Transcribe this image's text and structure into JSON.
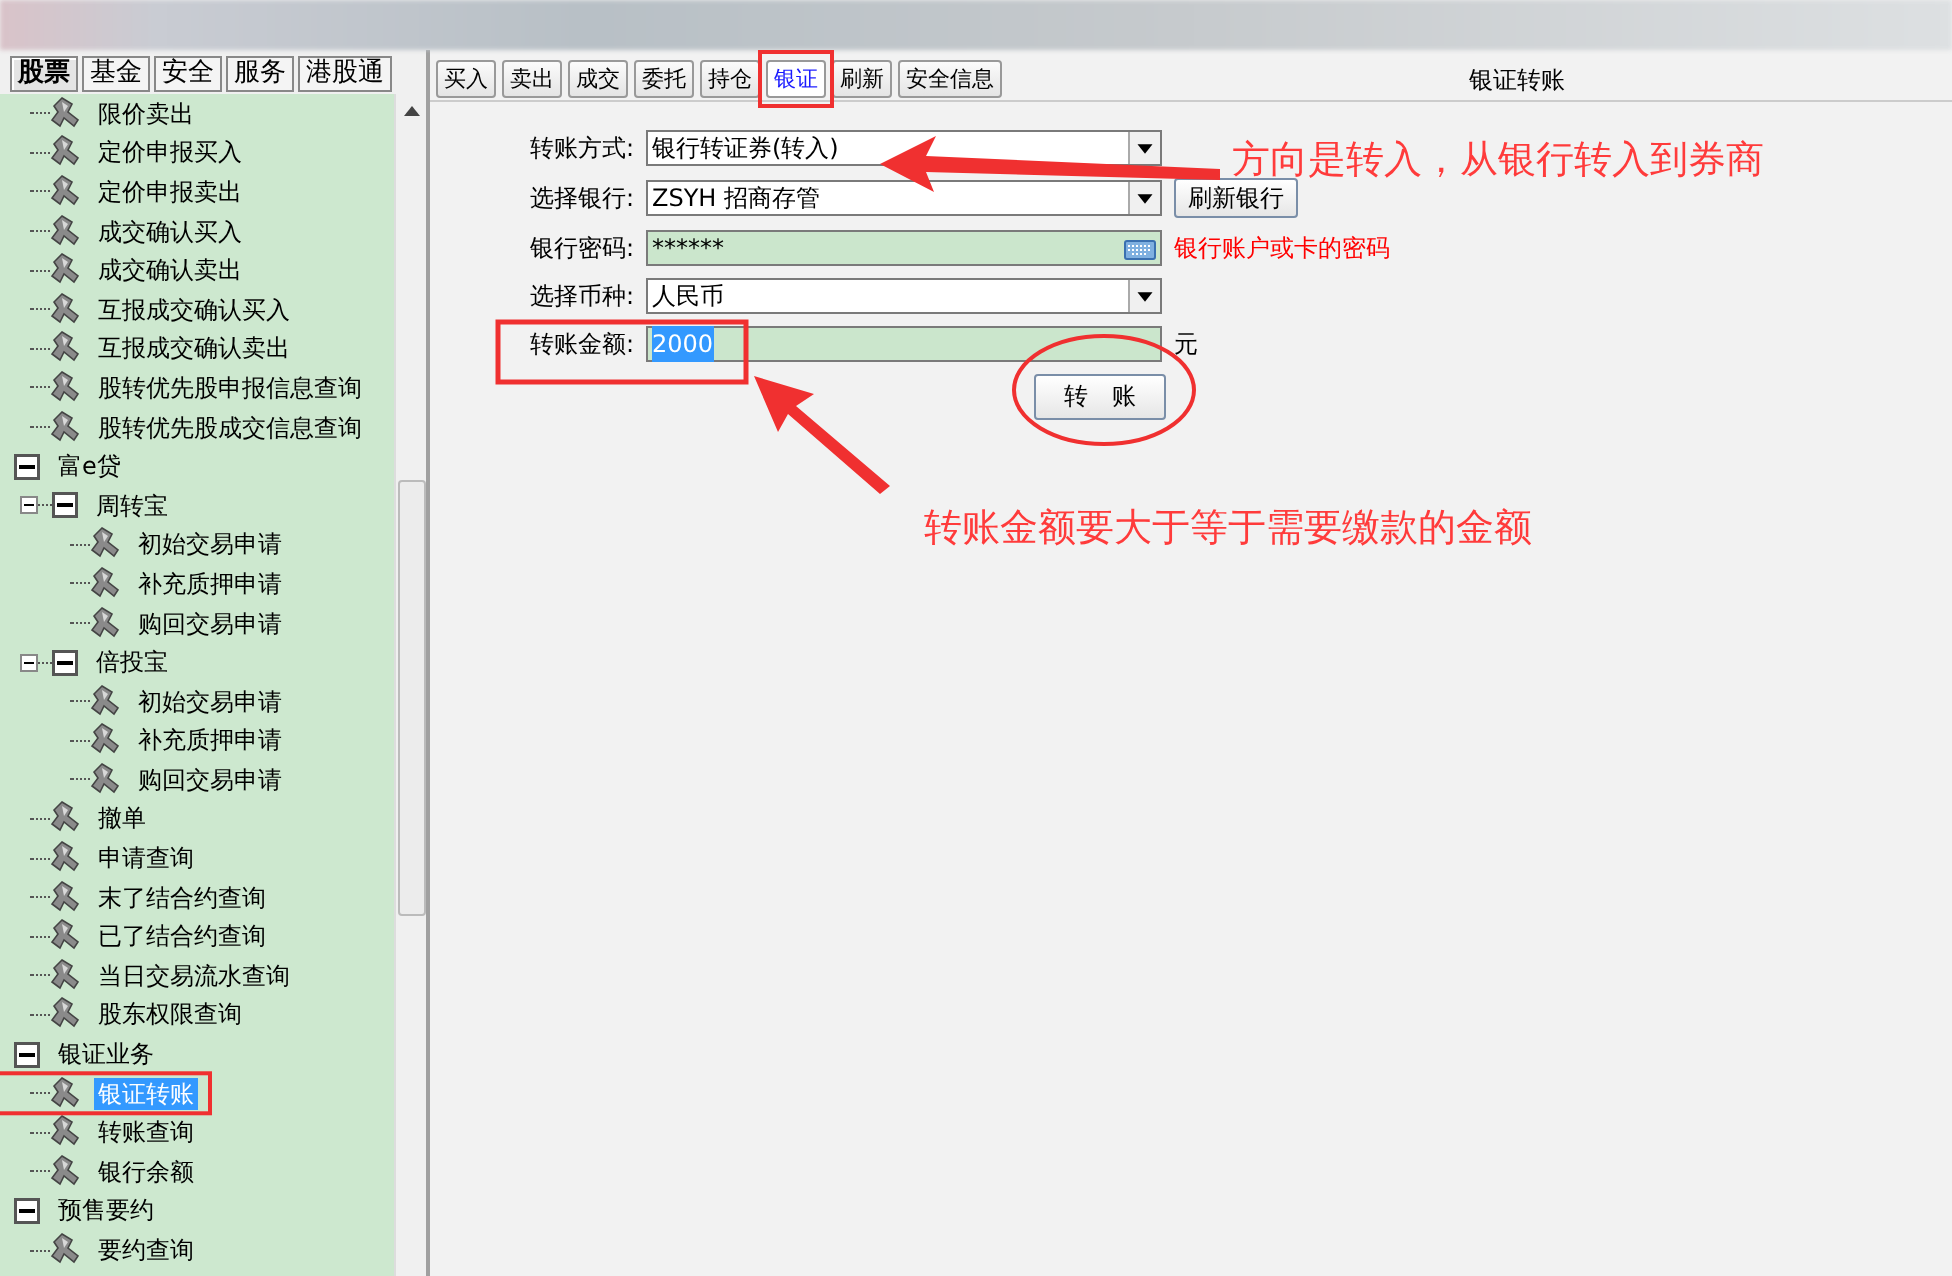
{
  "side_tabs": [
    {
      "label": "股票",
      "selected": true
    },
    {
      "label": "基金",
      "selected": false
    },
    {
      "label": "安全",
      "selected": false
    },
    {
      "label": "服务",
      "selected": false
    },
    {
      "label": "港股通",
      "selected": false
    }
  ],
  "tree": [
    {
      "label": "限价卖出",
      "kind": "leaf",
      "selected": false
    },
    {
      "label": "定价申报买入",
      "kind": "leaf",
      "selected": false
    },
    {
      "label": "定价申报卖出",
      "kind": "leaf",
      "selected": false
    },
    {
      "label": "成交确认买入",
      "kind": "leaf",
      "selected": false
    },
    {
      "label": "成交确认卖出",
      "kind": "leaf",
      "selected": false
    },
    {
      "label": "互报成交确认买入",
      "kind": "leaf",
      "selected": false
    },
    {
      "label": "互报成交确认卖出",
      "kind": "leaf",
      "selected": false
    },
    {
      "label": "股转优先股申报信息查询",
      "kind": "leaf",
      "selected": false
    },
    {
      "label": "股转优先股成交信息查询",
      "kind": "leaf",
      "selected": false
    },
    {
      "label": "富e贷",
      "kind": "group",
      "expanded": true,
      "children": [
        {
          "label": "周转宝",
          "kind": "group",
          "expanded": true,
          "children": [
            {
              "label": "初始交易申请",
              "kind": "leaf",
              "selected": false
            },
            {
              "label": "补充质押申请",
              "kind": "leaf",
              "selected": false
            },
            {
              "label": "购回交易申请",
              "kind": "leaf",
              "selected": false
            }
          ]
        },
        {
          "label": "倍投宝",
          "kind": "group",
          "expanded": true,
          "children": [
            {
              "label": "初始交易申请",
              "kind": "leaf",
              "selected": false
            },
            {
              "label": "补充质押申请",
              "kind": "leaf",
              "selected": false
            },
            {
              "label": "购回交易申请",
              "kind": "leaf",
              "selected": false
            }
          ]
        },
        {
          "label": "撤单",
          "kind": "leaf",
          "selected": false
        },
        {
          "label": "申请查询",
          "kind": "leaf",
          "selected": false
        },
        {
          "label": "末了结合约查询",
          "kind": "leaf",
          "selected": false
        },
        {
          "label": "已了结合约查询",
          "kind": "leaf",
          "selected": false
        },
        {
          "label": "当日交易流水查询",
          "kind": "leaf",
          "selected": false
        },
        {
          "label": "股东权限查询",
          "kind": "leaf",
          "selected": false
        }
      ]
    },
    {
      "label": "银证业务",
      "kind": "group",
      "expanded": true,
      "children": [
        {
          "label": "银证转账",
          "kind": "leaf",
          "selected": true
        },
        {
          "label": "转账查询",
          "kind": "leaf",
          "selected": false
        },
        {
          "label": "银行余额",
          "kind": "leaf",
          "selected": false
        }
      ]
    },
    {
      "label": "预售要约",
      "kind": "group",
      "expanded": true,
      "children": [
        {
          "label": "要约查询",
          "kind": "leaf",
          "selected": false
        }
      ]
    }
  ],
  "toolbar": [
    {
      "label": "买入",
      "selected": false
    },
    {
      "label": "卖出",
      "selected": false
    },
    {
      "label": "成交",
      "selected": false
    },
    {
      "label": "委托",
      "selected": false
    },
    {
      "label": "持仓",
      "selected": false
    },
    {
      "label": "银证",
      "selected": true
    },
    {
      "label": "刷新",
      "selected": false
    },
    {
      "label": "安全信息",
      "selected": false
    }
  ],
  "panel_title": "银证转账",
  "form": {
    "fields": [
      {
        "label": "转账方式:",
        "kind": "select",
        "value": "银行转证券(转入)",
        "value_selected": false
      },
      {
        "label": "选择银行:",
        "kind": "select",
        "value": "ZSYH 招商存管",
        "value_selected": false,
        "action": "刷新银行"
      },
      {
        "label": "银行密码:",
        "kind": "password",
        "value": "******",
        "value_selected": false,
        "hint": "银行账户或卡的密码"
      },
      {
        "label": "选择币种:",
        "kind": "select",
        "value": "人民币",
        "value_selected": false
      },
      {
        "label": "转账金额:",
        "kind": "amount",
        "value": "2000",
        "value_selected": true,
        "unit": "元"
      }
    ],
    "submit": "转　账"
  },
  "annotations": [
    {
      "kind": "callout",
      "text": "方向是转入，从银行转入到券商"
    },
    {
      "kind": "callout",
      "text": "转账金额要大于等于需要缴款的金额"
    }
  ]
}
